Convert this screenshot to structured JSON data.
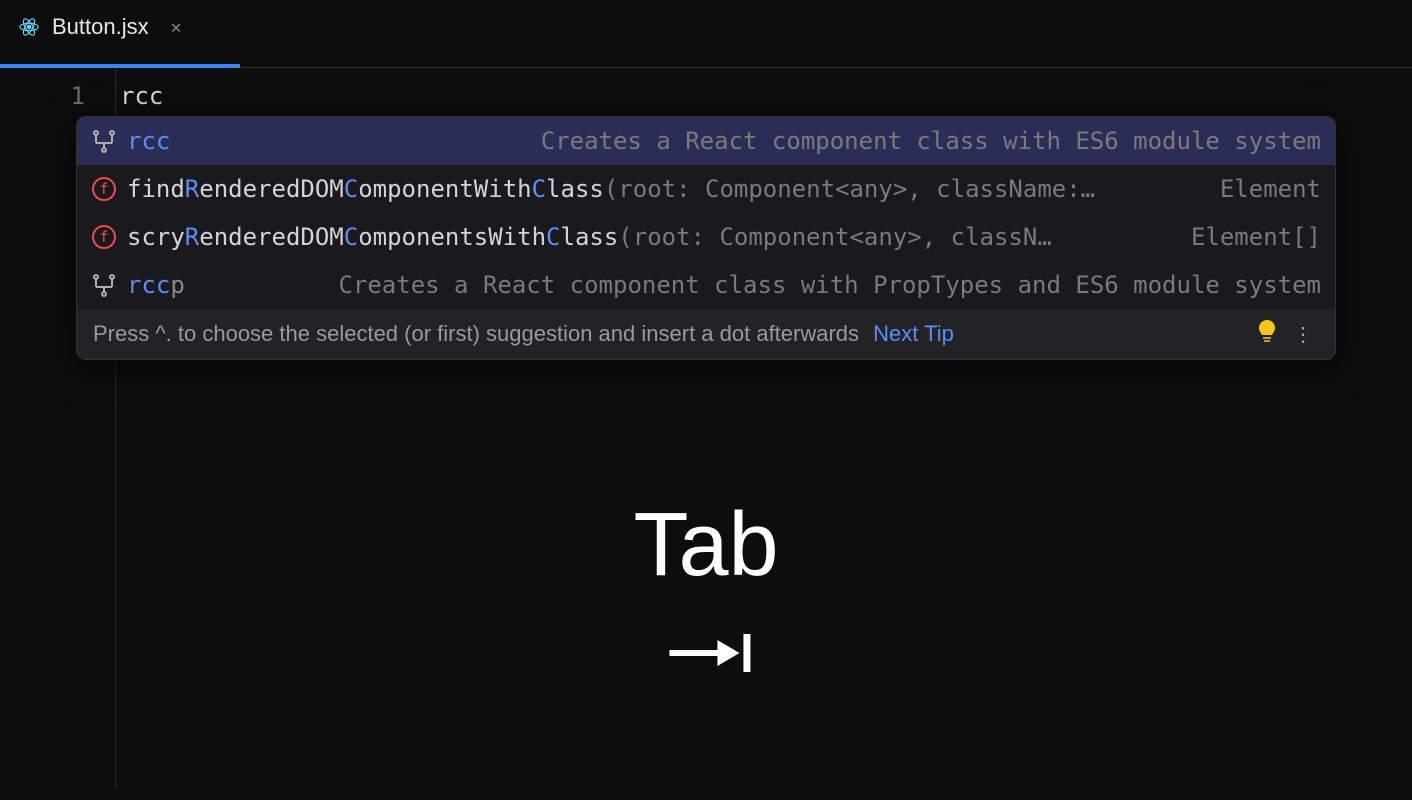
{
  "tab": {
    "filename": "Button.jsx",
    "line_number": "1",
    "code": "rcc"
  },
  "autocomplete": {
    "suggestions": [
      {
        "icon": "snippet",
        "label_parts": [
          {
            "t": "rcc",
            "hl": true
          }
        ],
        "params": "",
        "detail": "Creates a React component class with ES6 module system"
      },
      {
        "icon": "function",
        "label_parts": [
          {
            "t": "find",
            "hl": false
          },
          {
            "t": "R",
            "hl": true
          },
          {
            "t": "enderedDOM",
            "hl": false
          },
          {
            "t": "C",
            "hl": true
          },
          {
            "t": "omponentWith",
            "hl": false
          },
          {
            "t": "C",
            "hl": true
          },
          {
            "t": "lass",
            "hl": false
          }
        ],
        "params": "(root: Component<any>, className:…",
        "detail": "Element"
      },
      {
        "icon": "function",
        "label_parts": [
          {
            "t": "scry",
            "hl": false
          },
          {
            "t": "R",
            "hl": true
          },
          {
            "t": "enderedDOM",
            "hl": false
          },
          {
            "t": "C",
            "hl": true
          },
          {
            "t": "omponentsWith",
            "hl": false
          },
          {
            "t": "C",
            "hl": true
          },
          {
            "t": "lass",
            "hl": false
          }
        ],
        "params": "(root: Component<any>, classN…",
        "detail": "Element[]"
      },
      {
        "icon": "snippet",
        "label_parts": [
          {
            "t": "rcc",
            "hl": true
          },
          {
            "t": "p",
            "dim": true
          }
        ],
        "params": "",
        "detail": "Creates a React component class with PropTypes and ES6 module system"
      }
    ],
    "footer": {
      "tip_text": "Press ^. to choose the selected (or first) suggestion and insert a dot afterwards",
      "next_tip": "Next Tip"
    }
  },
  "overlay": {
    "key_label": "Tab"
  }
}
